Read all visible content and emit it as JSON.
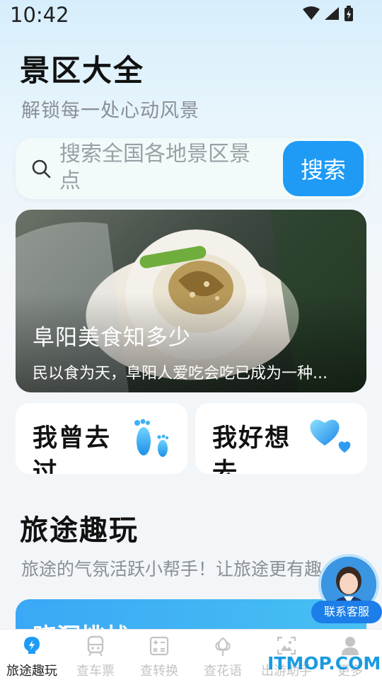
{
  "status_bar": {
    "time": "10:42",
    "icons": [
      "wifi-icon",
      "signal-icon",
      "battery-icon"
    ]
  },
  "header": {
    "title": "景区大全",
    "subtitle": "解锁每一处心动风景"
  },
  "search": {
    "placeholder": "搜索全国各地景区景点",
    "button_label": "搜索",
    "accent": "#1f9bf6"
  },
  "banner": {
    "title": "阜阳美食知多少",
    "description": "民以食为天，阜阳人爱吃会吃已成为一种..."
  },
  "quick_cards": [
    {
      "label": "我曾去过",
      "icon": "footprints-icon"
    },
    {
      "label": "我好想去",
      "icon": "heart-icon"
    }
  ],
  "section": {
    "title": "旅途趣玩",
    "subtitle": "旅途的气氛活跃小帮手！让旅途更有趣",
    "challenge_title": "晓洞挑战"
  },
  "customer_service": {
    "label": "联系客服"
  },
  "tabs": [
    {
      "label": "旅途趣玩",
      "icon": "lightbulb-icon",
      "active": true
    },
    {
      "label": "查车票",
      "icon": "train-icon",
      "active": false
    },
    {
      "label": "查转换",
      "icon": "calculator-icon",
      "active": false
    },
    {
      "label": "查花语",
      "icon": "flower-icon",
      "active": false
    },
    {
      "label": "出游助手",
      "icon": "photo-frame-icon",
      "active": false
    },
    {
      "label": "更多",
      "icon": "user-icon",
      "active": false
    }
  ],
  "watermark": "ITMOP.COM"
}
